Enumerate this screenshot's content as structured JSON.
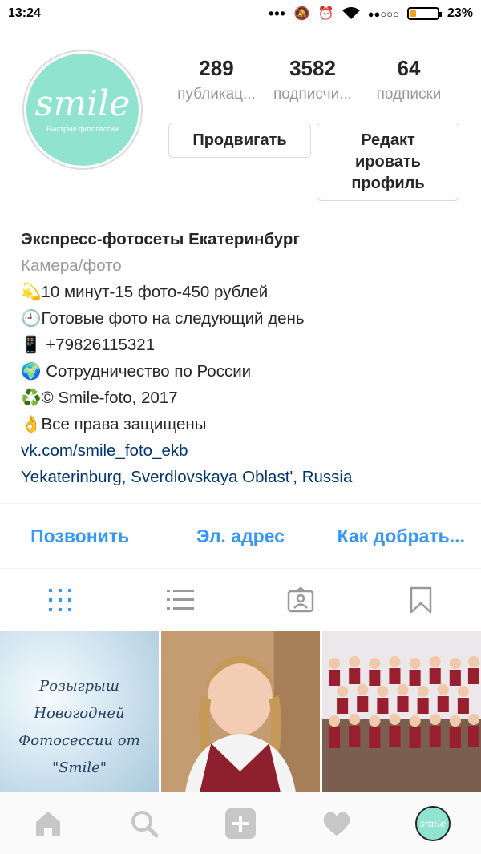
{
  "status_bar": {
    "time": "13:24",
    "signal": "●●○○○",
    "battery": "23%",
    "battery_level": 0.23
  },
  "profile": {
    "avatar": {
      "logo": "smile",
      "tagline": "Быстрые фотосессии"
    },
    "stats": [
      {
        "value": "289",
        "label": "публикац..."
      },
      {
        "value": "3582",
        "label": "подписчи..."
      },
      {
        "value": "64",
        "label": "подписки"
      }
    ],
    "promote_label": "Продвигать",
    "edit_label": "Редакт ировать профиль"
  },
  "bio": {
    "name": "Экспресс-фотосеты Екатеринбург",
    "category": "Камера/фото",
    "lines": [
      {
        "emoji": "💫",
        "text": "10 минут-15 фото-450 рублей"
      },
      {
        "emoji": "🕘",
        "text": "Готовые фото на следующий день"
      },
      {
        "emoji": "📱",
        "text": " +79826115321"
      },
      {
        "emoji": "🌍",
        "text": " Сотрудничество по России"
      },
      {
        "emoji": "♻️",
        "text": "© Smile-foto, 2017"
      },
      {
        "emoji": "👌",
        "text": "Все права защищены"
      }
    ],
    "website": "vk.com/smile_foto_ekb",
    "location": "Yekaterinburg, Sverdlovskaya Oblast', Russia"
  },
  "contact": {
    "call": "Позвонить",
    "email": "Эл. адрес",
    "directions": "Как добрать..."
  },
  "tabs": [
    {
      "icon": "grid-icon",
      "active": true
    },
    {
      "icon": "list-icon",
      "active": false
    },
    {
      "icon": "tagged-icon",
      "active": false
    },
    {
      "icon": "bookmark-icon",
      "active": false
    }
  ],
  "posts": [
    {
      "caption": "Розыгрыш Новогодней Фотосессии от \"Smile\""
    },
    {
      "caption": ""
    },
    {
      "caption": ""
    }
  ],
  "bottom_nav": [
    {
      "icon": "home-icon"
    },
    {
      "icon": "search-icon"
    },
    {
      "icon": "add-post-icon"
    },
    {
      "icon": "heart-icon"
    },
    {
      "icon": "profile-avatar-icon"
    }
  ],
  "colors": {
    "accent": "#3897f0",
    "link": "#003569",
    "avatar_bg": "#8fe3cf",
    "muted": "#999999"
  }
}
